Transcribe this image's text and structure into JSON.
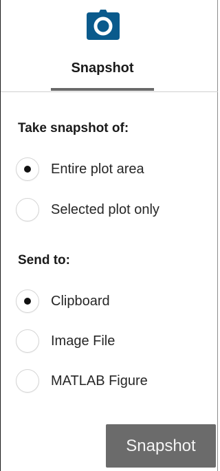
{
  "tab": {
    "label": "Snapshot",
    "icon": "camera-icon",
    "icon_color": "#0a5a8c"
  },
  "snapshot_of": {
    "title": "Take snapshot of:",
    "options": [
      {
        "label": "Entire plot area",
        "selected": true
      },
      {
        "label": "Selected plot only",
        "selected": false
      }
    ]
  },
  "send_to": {
    "title": "Send to:",
    "options": [
      {
        "label": "Clipboard",
        "selected": true
      },
      {
        "label": "Image File",
        "selected": false
      },
      {
        "label": "MATLAB Figure",
        "selected": false
      }
    ]
  },
  "action": {
    "label": "Snapshot",
    "color": "#6b6b6b"
  }
}
